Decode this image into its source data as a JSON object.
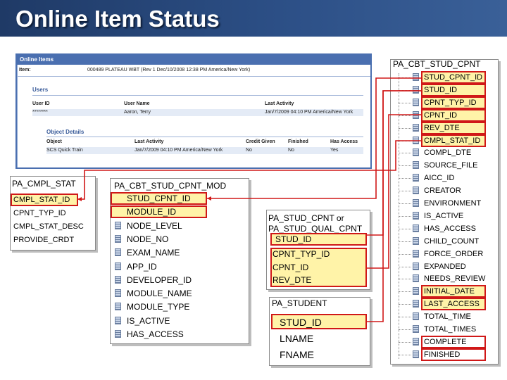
{
  "title": "Online Item Status",
  "screenshot": {
    "header": "Online Items",
    "item_label": "Item:",
    "item_value": "000489 PLATEAU WBT (Rev 1 Dec/10/2008 12:38 PM America/New York)",
    "users_section": "Users",
    "user_cols": [
      "User ID",
      "User Name",
      "Last Activity"
    ],
    "user_row": [
      "********",
      "Aaron, Terry",
      "Jan/7/2009 04:10 PM America/New York"
    ],
    "objects_section": "Object Details",
    "object_cols": [
      "Object",
      "Last Activity",
      "Credit Given",
      "Finished",
      "Has Access"
    ],
    "object_row": [
      "SCS Quick Train",
      "Jan/7/2009 04:10 PM America/New York",
      "No",
      "No",
      "Yes"
    ]
  },
  "tables": {
    "cbt_stud_cpnt": {
      "name": "PA_CBT_STUD_CPNT",
      "fields": [
        "STUD_CPNT_ID",
        "STUD_ID",
        "CPNT_TYP_ID",
        "CPNT_ID",
        "REV_DTE",
        "CMPL_STAT_ID",
        "COMPL_DTE",
        "SOURCE_FILE",
        "AICC_ID",
        "CREATOR",
        "ENVIRONMENT",
        "IS_ACTIVE",
        "HAS_ACCESS",
        "CHILD_COUNT",
        "FORCE_ORDER",
        "EXPANDED",
        "NEEDS_REVIEW",
        "INITIAL_DATE",
        "LAST_ACCESS",
        "TOTAL_TIME",
        "TOTAL_TIMES",
        "COMPLETE",
        "FINISHED"
      ]
    },
    "cmpl_stat": {
      "name": "PA_CMPL_STAT",
      "fields": [
        "CMPL_STAT_ID",
        "CPNT_TYP_ID",
        "CMPL_STAT_DESC",
        "PROVIDE_CRDT"
      ]
    },
    "cbt_stud_cpnt_mod": {
      "name": "PA_CBT_STUD_CPNT_MOD",
      "fields": [
        "STUD_CPNT_ID",
        "MODULE_ID",
        "NODE_LEVEL",
        "NODE_NO",
        "EXAM_NAME",
        "APP_ID",
        "DEVELOPER_ID",
        "MODULE_NAME",
        "MODULE_TYPE",
        "IS_ACTIVE",
        "HAS_ACCESS"
      ]
    },
    "stud_cpnt": {
      "name_line1": "PA_STUD_CPNT or",
      "name_line2": "PA_STUD_QUAL_CPNT",
      "fields": [
        "STUD_ID",
        "CPNT_TYP_ID",
        "CPNT_ID",
        "REV_DTE"
      ]
    },
    "student": {
      "name": "PA_STUDENT",
      "fields": [
        "STUD_ID",
        "LNAME",
        "FNAME"
      ]
    }
  },
  "colors": {
    "title_bar": "#2c4f86",
    "highlight": "#fff3a8",
    "connector": "#d01818",
    "icon": "#6b7fa0"
  }
}
